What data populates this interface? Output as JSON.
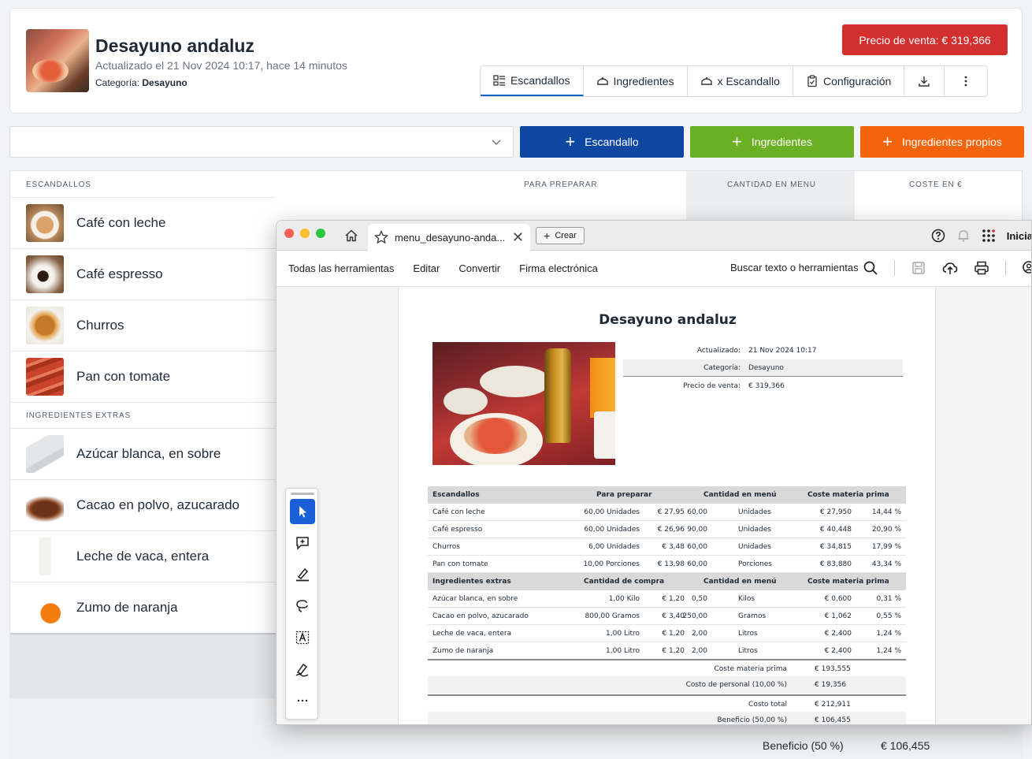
{
  "header": {
    "title": "Desayuno andaluz",
    "updated": "Actualizado el 21 Nov 2024 10:17, hace 14 minutos",
    "category_label": "Categoría:",
    "category_value": "Desayuno",
    "price_button": "Precio de venta: € 319,366",
    "tabs": [
      {
        "label": "Escandallos",
        "icon": "list-icon",
        "active": true
      },
      {
        "label": "Ingredientes",
        "icon": "bowl-icon",
        "active": false
      },
      {
        "label": "x Escandallo",
        "icon": "bowl-icon",
        "active": false
      },
      {
        "label": "Configuración",
        "icon": "clipboard-icon",
        "active": false
      }
    ]
  },
  "actions": {
    "add_escandallo": "Escandallo",
    "add_ingredientes": "Ingredientes",
    "add_propios": "Ingredientes propios"
  },
  "table": {
    "headers": {
      "escandallos": "ESCANDALLOS",
      "para_preparar": "PARA PREPARAR",
      "cantidad_menu": "CANTIDAD EN MENU",
      "coste": "COSTE EN €"
    },
    "escandallos": [
      "Café con leche",
      "Café espresso",
      "Churros",
      "Pan con tomate"
    ],
    "extras_header": "INGREDIENTES EXTRAS",
    "extras": [
      "Azúcar blanca, en sobre",
      "Cacao en polvo, azucarado",
      "Leche de vaca, entera",
      "Zumo de naranja"
    ],
    "footer": {
      "beneficio_label": "Beneficio (50 %)",
      "beneficio_value": "€ 106,455"
    }
  },
  "viewer": {
    "tab_title": "menu_desayuno-anda...",
    "crear": "Crear",
    "account_text": "Inicia",
    "menu": [
      "Todas las herramientas",
      "Editar",
      "Convertir",
      "Firma electrónica"
    ],
    "search": "Buscar texto o herramientas",
    "pdf": {
      "title": "Desayuno andaluz",
      "meta": [
        {
          "label": "Actualizado:",
          "value": "21 Nov 2024 10:17"
        },
        {
          "label": "Categoría:",
          "value": "Desayuno"
        },
        {
          "label": "Precio de venta:",
          "value": "€ 319,366"
        }
      ],
      "esc_header": {
        "name": "Escandallos",
        "prep": "Para preparar",
        "menu": "Cantidad en menú",
        "cost": "Coste materia prima"
      },
      "esc_rows": [
        {
          "name": "Café con leche",
          "qty": "60,00 Unidades",
          "price": "€ 27,95",
          "mq": "60,00",
          "mu": "Unidades",
          "cost": "€ 27,950",
          "pct": "14,44 %"
        },
        {
          "name": "Café espresso",
          "qty": "60,00 Unidades",
          "price": "€ 26,96",
          "mq": "90,00",
          "mu": "Unidades",
          "cost": "€ 40,448",
          "pct": "20,90 %"
        },
        {
          "name": "Churros",
          "qty": "6,00 Unidades",
          "price": "€ 3,48",
          "mq": "60,00",
          "mu": "Unidades",
          "cost": "€ 34,815",
          "pct": "17,99 %"
        },
        {
          "name": "Pan con tomate",
          "qty": "10,00 Porciones",
          "price": "€ 13,98",
          "mq": "60,00",
          "mu": "Porciones",
          "cost": "€ 83,880",
          "pct": "43,34 %"
        }
      ],
      "ext_header": {
        "name": "Ingredientes extras",
        "buy": "Cantidad de compra",
        "menu": "Cantidad en menú",
        "cost": "Coste materia prima"
      },
      "ext_rows": [
        {
          "name": "Azúcar blanca, en sobre",
          "qty": "1,00 Kilo",
          "price": "€ 1,20",
          "mq": "0,50",
          "mu": "Kilos",
          "cost": "€ 0,600",
          "pct": "0,31 %"
        },
        {
          "name": "Cacao en polvo, azucarado",
          "qty": "800,00 Gramos",
          "price": "€ 3,40",
          "mq": "250,00",
          "mu": "Gramos",
          "cost": "€ 1,062",
          "pct": "0,55 %"
        },
        {
          "name": "Leche de vaca, entera",
          "qty": "1,00 Litro",
          "price": "€ 1,20",
          "mq": "2,00",
          "mu": "Litros",
          "cost": "€ 2,400",
          "pct": "1,24 %"
        },
        {
          "name": "Zumo de naranja",
          "qty": "1,00 Litro",
          "price": "€ 1,20",
          "mq": "2,00",
          "mu": "Litros",
          "cost": "€ 2,400",
          "pct": "1,24 %"
        }
      ],
      "totals": [
        {
          "label": "Coste materia prima",
          "value": "€ 193,555"
        },
        {
          "label": "Costo de personal (10,00 %)",
          "value": "€ 19,356"
        },
        {
          "label": "Costo total",
          "value": "€ 212,911"
        },
        {
          "label": "Beneficio (50,00 %)",
          "value": "€ 106,455"
        }
      ]
    }
  }
}
